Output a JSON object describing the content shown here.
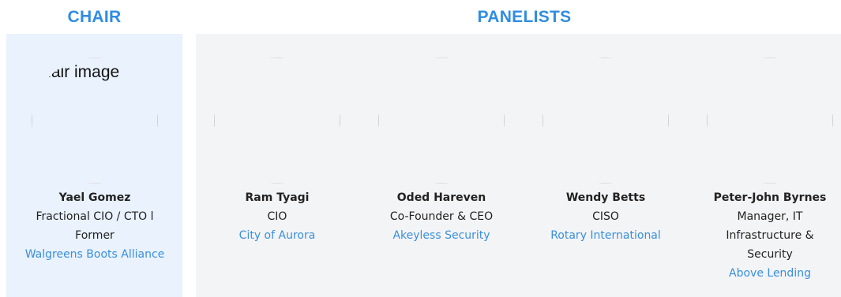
{
  "sections": {
    "chair_title": "CHAIR",
    "panelists_title": "PANELISTS"
  },
  "chair": {
    "image_alt": "Chair image",
    "name": "Yael Gomez",
    "title": "Fractional CIO / CTO l Former",
    "organization": "Walgreens Boots Alliance"
  },
  "panelists": [
    {
      "name": "Ram Tyagi",
      "title": "CIO",
      "organization": "City of Aurora"
    },
    {
      "name": "Oded Hareven",
      "title": "Co-Founder & CEO",
      "organization": "Akeyless Security"
    },
    {
      "name": "Wendy Betts",
      "title": "CISO",
      "organization": "Rotary International"
    },
    {
      "name": "Peter-John Byrnes",
      "title": "Manager, IT Infrastructure & Security",
      "organization": "Above Lending"
    }
  ],
  "colors": {
    "accent": "#2f8de0",
    "org_link": "#3a8fdc",
    "chair_bg": "#e9f2fd",
    "panel_bg": "#f3f4f6"
  }
}
